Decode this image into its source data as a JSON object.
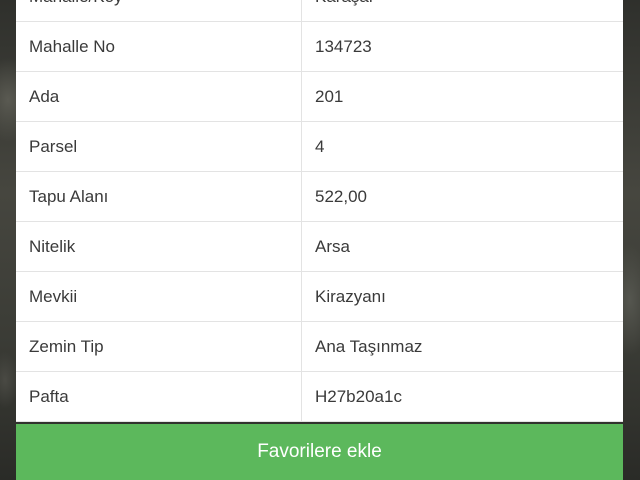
{
  "rows": [
    {
      "label": "Mahalle/Köy",
      "value": "Karaşar"
    },
    {
      "label": "Mahalle No",
      "value": "134723"
    },
    {
      "label": "Ada",
      "value": "201"
    },
    {
      "label": "Parsel",
      "value": "4"
    },
    {
      "label": "Tapu Alanı",
      "value": "522,00"
    },
    {
      "label": "Nitelik",
      "value": "Arsa"
    },
    {
      "label": "Mevkii",
      "value": "Kirazyanı"
    },
    {
      "label": "Zemin Tip",
      "value": "Ana Taşınmaz"
    },
    {
      "label": "Pafta",
      "value": "H27b20a1c"
    }
  ],
  "favorite_button": {
    "label": "Favorilere ekle"
  }
}
